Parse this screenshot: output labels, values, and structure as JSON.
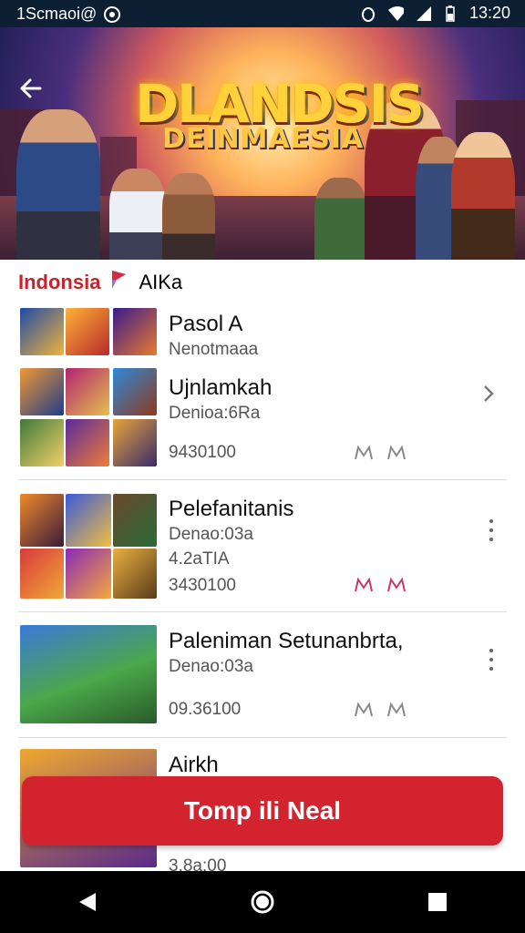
{
  "status_bar": {
    "left_text": "1Scmaoi@",
    "right_text": "13:20"
  },
  "hero": {
    "logo_line1": "DLANDSIS",
    "logo_line2": "DEINMAESIA"
  },
  "section": {
    "red_text": "Indonsia",
    "dark_text": "AIKa"
  },
  "cards": [
    {
      "title": "Pasol A",
      "subtitle": "Nenotmaaa",
      "title2": "Ujnlamkah",
      "subtitle2": "Denioa:6Ra",
      "number": "9430100"
    },
    {
      "title": "Pelefanitanis",
      "subtitle": "Denao:03a",
      "subtitle2": "4.2aTIA",
      "number": "3430100"
    },
    {
      "title": "Paleniman Setunanbrta,",
      "subtitle": "Denao:03a",
      "number": "09.36100"
    },
    {
      "title": "Airkh",
      "number": "3.8a:00"
    }
  ],
  "cta": {
    "label": "Tomp ili Neal"
  },
  "icons": {
    "back": "arrow-left-icon",
    "chevron": "chevron-right-icon",
    "more": "more-vert-icon",
    "nav_back": "nav-back-icon",
    "nav_home": "nav-home-icon",
    "nav_recent": "nav-recent-icon"
  },
  "colors": {
    "accent": "#d3232f",
    "status_bar": "#0d1f33"
  }
}
